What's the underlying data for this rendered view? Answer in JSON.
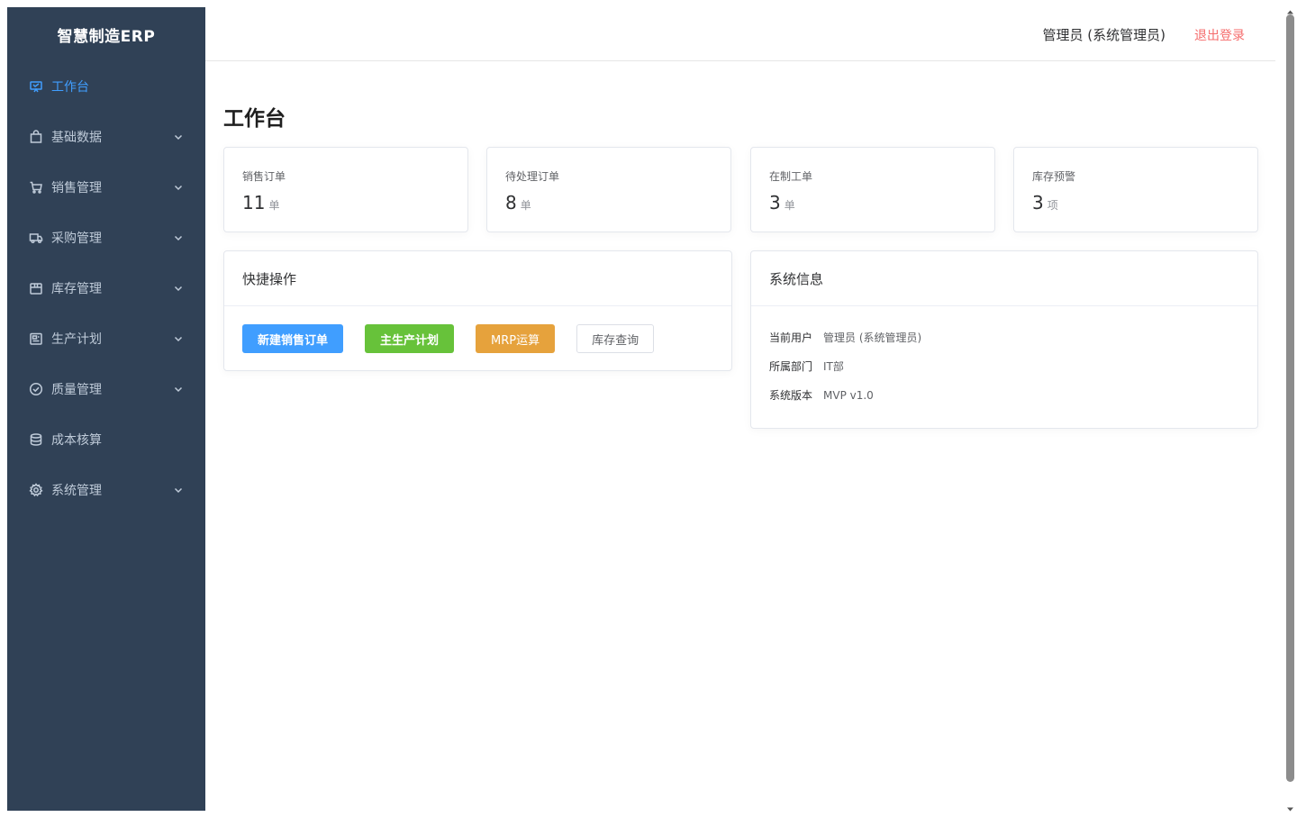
{
  "app": {
    "title": "智慧制造ERP"
  },
  "sidebar": {
    "items": [
      {
        "label": "工作台",
        "icon": "monitor-icon",
        "active": true,
        "expandable": false
      },
      {
        "label": "基础数据",
        "icon": "bag-icon",
        "active": false,
        "expandable": true
      },
      {
        "label": "销售管理",
        "icon": "cart-icon",
        "active": false,
        "expandable": true
      },
      {
        "label": "采购管理",
        "icon": "truck-icon",
        "active": false,
        "expandable": true
      },
      {
        "label": "库存管理",
        "icon": "box-icon",
        "active": false,
        "expandable": true
      },
      {
        "label": "生产计划",
        "icon": "calendar-icon",
        "active": false,
        "expandable": true
      },
      {
        "label": "质量管理",
        "icon": "check-circle-icon",
        "active": false,
        "expandable": true
      },
      {
        "label": "成本核算",
        "icon": "coin-icon",
        "active": false,
        "expandable": false
      },
      {
        "label": "系统管理",
        "icon": "gear-icon",
        "active": false,
        "expandable": true
      }
    ]
  },
  "header": {
    "user": "管理员 (系统管理员)",
    "logout": "退出登录"
  },
  "main": {
    "title": "工作台",
    "stats": [
      {
        "label": "销售订单",
        "value": "11",
        "unit": "单"
      },
      {
        "label": "待处理订单",
        "value": "8",
        "unit": "单"
      },
      {
        "label": "在制工单",
        "value": "3",
        "unit": "单"
      },
      {
        "label": "库存预警",
        "value": "3",
        "unit": "项"
      }
    ],
    "quick": {
      "title": "快捷操作",
      "buttons": [
        {
          "label": "新建销售订单",
          "type": "primary"
        },
        {
          "label": "主生产计划",
          "type": "success"
        },
        {
          "label": "MRP运算",
          "type": "warning"
        },
        {
          "label": "库存查询",
          "type": "plain"
        }
      ]
    },
    "sysinfo": {
      "title": "系统信息",
      "rows": [
        {
          "key": "当前用户",
          "value": "管理员 (系统管理员)"
        },
        {
          "key": "所属部门",
          "value": "IT部"
        },
        {
          "key": "系统版本",
          "value": "MVP v1.0"
        }
      ]
    }
  },
  "colors": {
    "sidebar_bg": "#304156",
    "sidebar_text": "#bfcbd9",
    "active": "#409eff",
    "primary": "#409eff",
    "success": "#67c23a",
    "warning": "#e6a23c",
    "danger": "#f56c6c"
  }
}
